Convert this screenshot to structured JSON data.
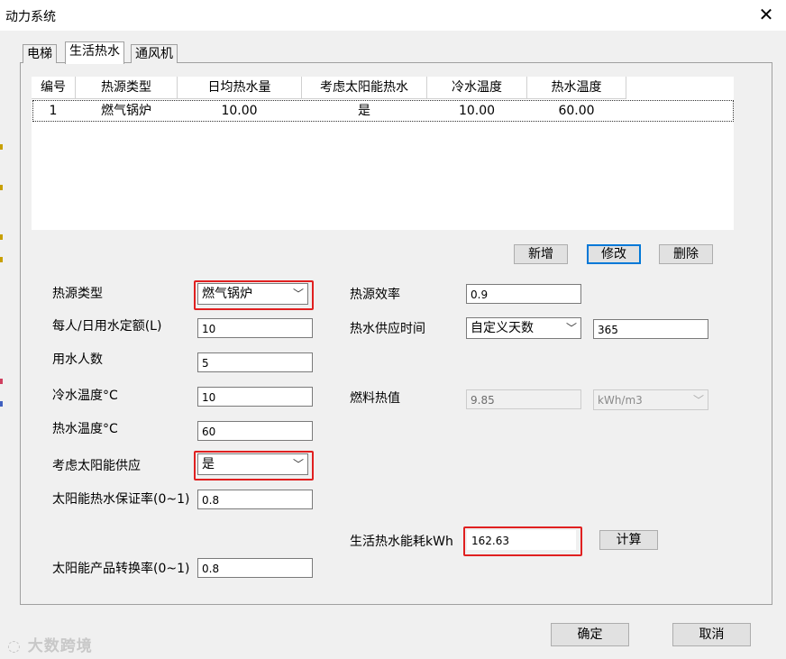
{
  "window": {
    "title": "动力系统",
    "close_glyph": "✕"
  },
  "tabs": [
    {
      "label": "电梯"
    },
    {
      "label": "生活热水",
      "active": true
    },
    {
      "label": "通风机"
    }
  ],
  "table": {
    "columns": [
      "编号",
      "热源类型",
      "日均热水量",
      "考虑太阳能热水",
      "冷水温度",
      "热水温度"
    ],
    "rows": [
      [
        "1",
        "燃气锅炉",
        "10.00",
        "是",
        "10.00",
        "60.00"
      ]
    ]
  },
  "row_buttons": {
    "add": "新增",
    "modify": "修改",
    "delete": "删除"
  },
  "form": {
    "heat_source_type": {
      "label": "热源类型",
      "value": "燃气锅炉"
    },
    "daily_quota": {
      "label": "每人/日用水定额(L)",
      "value": "10"
    },
    "people": {
      "label": "用水人数",
      "value": "5"
    },
    "cold_temp": {
      "label": "冷水温度°C",
      "value": "10"
    },
    "hot_temp": {
      "label": "热水温度°C",
      "value": "60"
    },
    "solar": {
      "label": "考虑太阳能供应",
      "value": "是"
    },
    "solar_guarantee": {
      "label": "太阳能热水保证率(0~1)",
      "value": "0.8"
    },
    "solar_conversion": {
      "label": "太阳能产品转换率(0~1)",
      "value": "0.8"
    },
    "efficiency": {
      "label": "热源效率",
      "value": "0.9"
    },
    "supply_time": {
      "label": "热水供应时间",
      "mode": "自定义天数",
      "days": "365"
    },
    "fuel_heat": {
      "label": "燃料热值",
      "value": "9.85",
      "unit": "kWh/m3"
    },
    "energy": {
      "label": "生活热水能耗kWh",
      "value": "162.63"
    },
    "calc_label": "计算"
  },
  "footer": {
    "ok": "确定",
    "cancel": "取消"
  },
  "watermark": "大数跨境",
  "colors": {
    "highlight": "#e02020",
    "focus": "#0078d7"
  }
}
